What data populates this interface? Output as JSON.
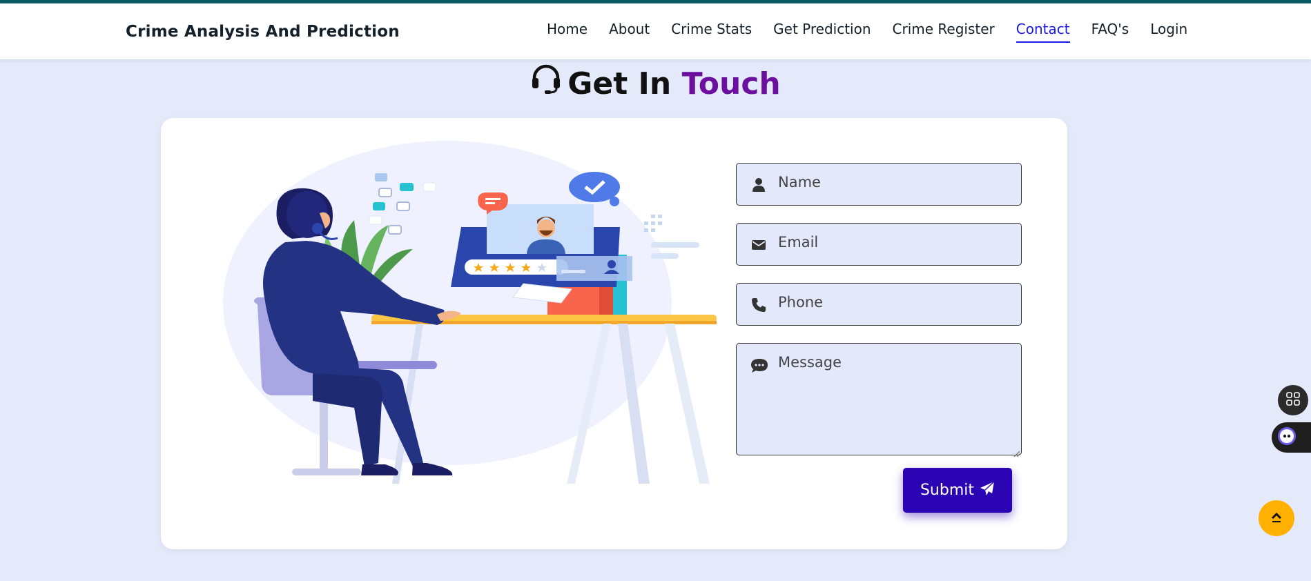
{
  "header": {
    "brand": "Crime Analysis And Prediction",
    "nav": [
      {
        "label": "Home",
        "active": false
      },
      {
        "label": "About",
        "active": false
      },
      {
        "label": "Crime Stats",
        "active": false
      },
      {
        "label": "Get Prediction",
        "active": false
      },
      {
        "label": "Crime Register",
        "active": false
      },
      {
        "label": "Contact",
        "active": true
      },
      {
        "label": "FAQ's",
        "active": false
      },
      {
        "label": "Login",
        "active": false
      }
    ]
  },
  "heading": {
    "icon": "headset-icon",
    "text": "Get In",
    "accent": "Touch",
    "accent_color": "#6a0fa0"
  },
  "form": {
    "name_placeholder": "Name",
    "email_placeholder": "Email",
    "phone_placeholder": "Phone",
    "message_placeholder": "Message",
    "submit_label": "Submit"
  },
  "colors": {
    "active_link": "#1a1ae6",
    "submit_bg": "#2b05b4",
    "scroll_top_bg": "#ffb000",
    "page_bg": "#e4eafa"
  },
  "illustration": {
    "rating_stars": 4
  }
}
